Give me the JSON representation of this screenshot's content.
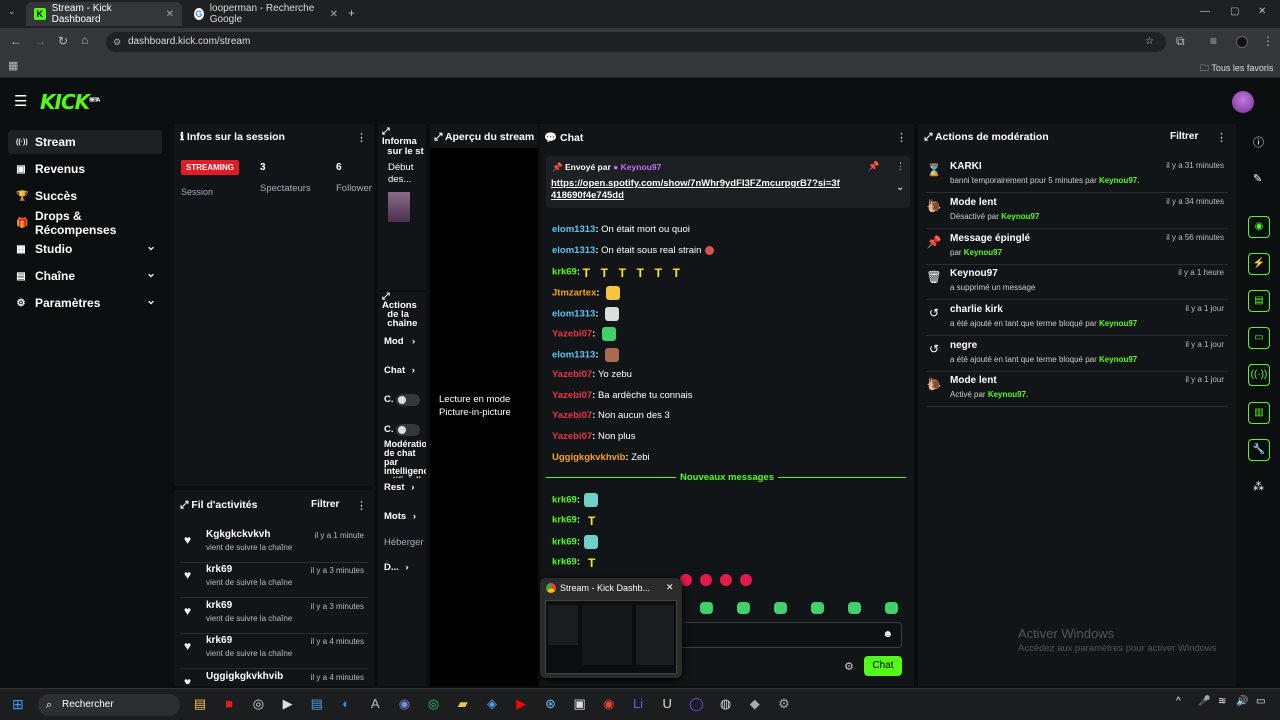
{
  "browser": {
    "tabs": [
      {
        "title": "Stream - Kick Dashboard",
        "active": true
      },
      {
        "title": "looperman - Recherche Google",
        "active": false
      }
    ],
    "url": "dashboard.kick.com/stream",
    "bookmarks_label": "Tous les favoris"
  },
  "kick": {
    "logo": "KICK",
    "logo_badge": "BETA",
    "accent": "#53fc18"
  },
  "sidebar": {
    "items": [
      {
        "label": "Stream",
        "icon": "stream-icon",
        "active": true
      },
      {
        "label": "Revenus",
        "icon": "revenue-icon"
      },
      {
        "label": "Succès",
        "icon": "trophy-icon"
      },
      {
        "label": "Drops & Récompenses",
        "icon": "gift-icon"
      },
      {
        "label": "Studio",
        "icon": "studio-icon",
        "expandable": true
      },
      {
        "label": "Chaîne",
        "icon": "channel-icon",
        "expandable": true
      },
      {
        "label": "Paramètres",
        "icon": "gear-icon",
        "expandable": true
      }
    ]
  },
  "session": {
    "title": "Infos sur la session",
    "badge": "STREAMING",
    "badge_sub": "Session",
    "viewers_value": "3",
    "viewers_label": "Spectateurs",
    "followers_value": "6",
    "followers_label": "Follower"
  },
  "info_panel": {
    "title_1": "Informa",
    "title_2": "sur le st",
    "subtitle": "Début des..."
  },
  "channel_actions": {
    "title_1": "Actions",
    "title_2": "de la",
    "title_3": "chaîne",
    "items": [
      "Mod",
      "Chat",
      "C.",
      "C.",
      "Modération de chat par intelligence artificielle",
      "Rest",
      "Mots",
      "Héberger",
      "D..."
    ]
  },
  "preview": {
    "title": "Aperçu du stream",
    "pip_text": "Lecture en mode Picture-in-picture"
  },
  "chat": {
    "title": "Chat",
    "pinned_by_label": "Envoyé par",
    "pinned_by_user": "Keynou97",
    "pinned_link": "https://open.spotify.com/show/7nWhr9ydFI3FZmcurpgrB7?si=3f418690f4e745dd",
    "new_messages_label": "Nouveaux messages",
    "send_label": "Chat",
    "messages": [
      {
        "user": "elom1313",
        "text": "On était mort ou quoi"
      },
      {
        "user": "elom1313",
        "text": "On était sous real strain"
      },
      {
        "user": "krk69",
        "text": ""
      },
      {
        "user": "Jtmzartex",
        "text": ""
      },
      {
        "user": "elom1313",
        "text": ""
      },
      {
        "user": "Yazebi07",
        "text": ""
      },
      {
        "user": "elom1313",
        "text": ""
      },
      {
        "user": "Yazebi07",
        "text": "Yo zebu"
      },
      {
        "user": "Yazebi07",
        "text": "Ba ardèche tu connais"
      },
      {
        "user": "Yazebi07",
        "text": "Non aucun des 3"
      },
      {
        "user": "Yazebi07",
        "text": "Non plus"
      },
      {
        "user": "Uggigkgkvkhvib",
        "text": "Zebi"
      }
    ],
    "new_messages": [
      {
        "user": "krk69"
      },
      {
        "user": "krk69"
      },
      {
        "user": "krk69"
      },
      {
        "user": "krk69"
      }
    ]
  },
  "activity": {
    "title": "Fil d'activités",
    "filter_label": "Filtrer",
    "items": [
      {
        "name": "Kgkgkckvkvh",
        "sub": "vient de suivre la chaîne",
        "time": "il y a 1 minute"
      },
      {
        "name": "krk69",
        "sub": "vient de suivre la chaîne",
        "time": "il y a 3 minutes"
      },
      {
        "name": "krk69",
        "sub": "vient de suivre la chaîne",
        "time": "il y a 3 minutes"
      },
      {
        "name": "krk69",
        "sub": "vient de suivre la chaîne",
        "time": "il y a 4 minutes"
      },
      {
        "name": "Uggigkgkvkhvib",
        "sub": "",
        "time": "il y a 4 minutes"
      }
    ]
  },
  "moderation": {
    "title": "Actions de modération",
    "filter_label": "Filtrer",
    "items": [
      {
        "title": "KARKI",
        "sub": "banni temporairement pour 5 minutes par",
        "by": "Keynou97.",
        "time": "il y a 31 minutes",
        "icon": "hourglass-icon"
      },
      {
        "title": "Mode lent",
        "sub": "Désactivé par",
        "by": "Keynou97",
        "time": "il y a 34 minutes",
        "icon": "snail-icon"
      },
      {
        "title": "Message épinglé",
        "sub": "par",
        "by": "Keynou97",
        "time": "il y a 56 minutes",
        "icon": "pin-icon"
      },
      {
        "title": "Keynou97",
        "sub": "a supprimé un message",
        "by": "",
        "time": "il y a 1 heure",
        "icon": "trash-icon"
      },
      {
        "title": "charlie kirk",
        "sub": "a été ajouté en tant que terme bloqué par",
        "by": "Keynou97",
        "time": "il y a 1 jour",
        "icon": "history-icon"
      },
      {
        "title": "negre",
        "sub": "a été ajouté en tant que terme bloqué par",
        "by": "Keynou97",
        "time": "il y a 1 jour",
        "icon": "history-icon"
      },
      {
        "title": "Mode lent",
        "sub": "Activé par",
        "by": "Keynou97.",
        "time": "il y a 1 jour",
        "icon": "snail-icon"
      }
    ]
  },
  "windows": {
    "watermark_1": "Activer Windows",
    "watermark_2": "Accédez aux paramètres pour activer Windows",
    "search_label": "Rechercher",
    "thumbnail_title": "Stream - Kick Dashb..."
  }
}
